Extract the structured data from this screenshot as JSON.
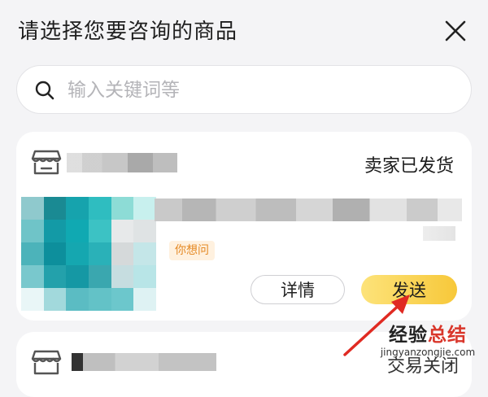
{
  "header": {
    "title": "请选择您要咨询的商品"
  },
  "search": {
    "placeholder": "输入关键词等"
  },
  "orders": [
    {
      "status": "卖家已发货",
      "tag": "你想问",
      "detail_label": "详情",
      "send_label": "发送"
    },
    {
      "status": "交易关闭"
    }
  ],
  "watermark": {
    "main_prefix": "经验",
    "main_accent": "总结",
    "sub": "jingyanzongjie.com"
  },
  "colors": {
    "send_gradient_start": "#fde37a",
    "send_gradient_end": "#f7c83a",
    "tag_text": "#e58a26",
    "tag_bg": "#fff1df",
    "arrow": "#e02a22",
    "page_bg": "#f4f4f6"
  }
}
